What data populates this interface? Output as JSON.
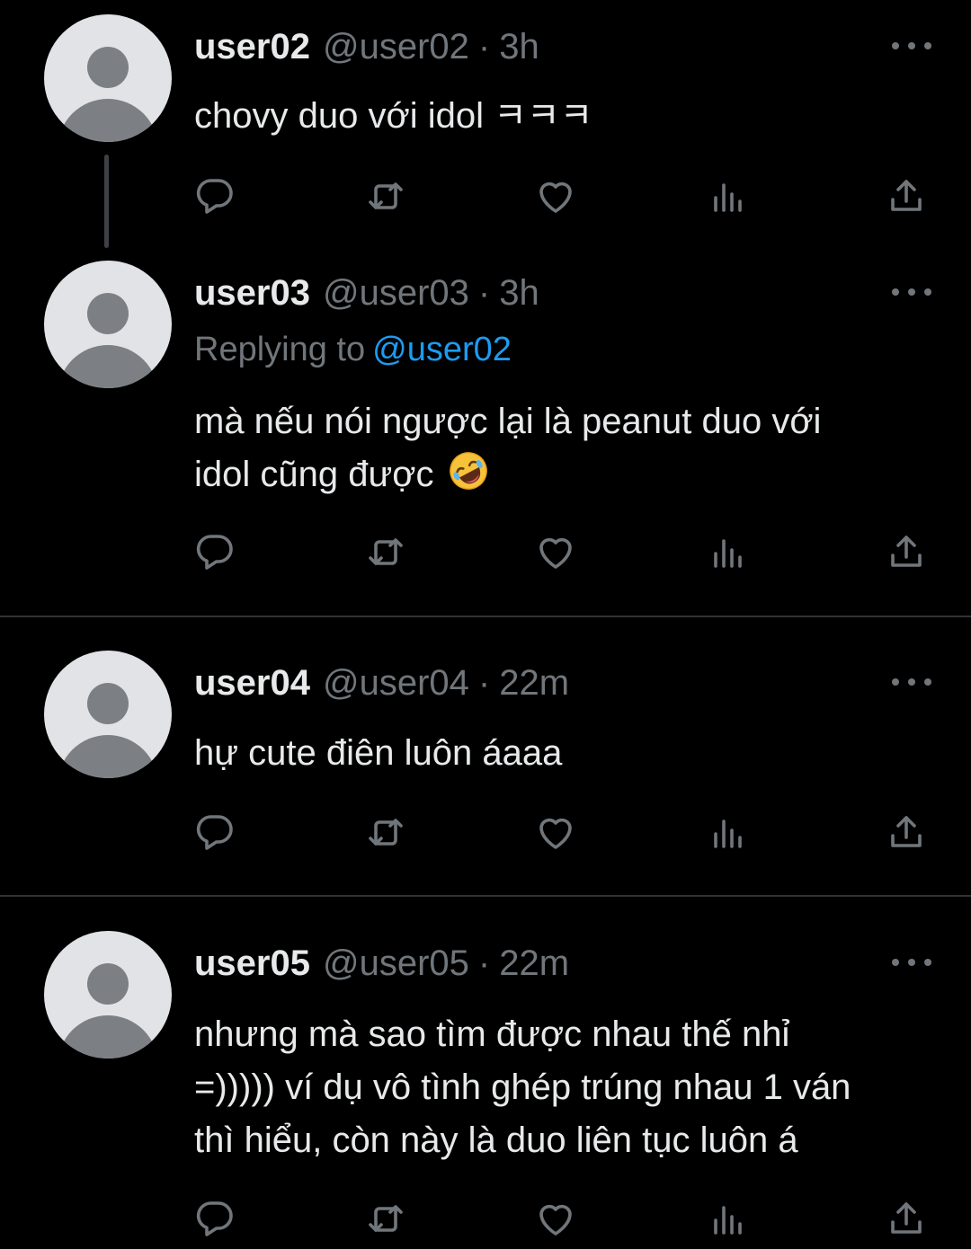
{
  "tweets": [
    {
      "name": "user02",
      "handle": "@user02",
      "sep": "·",
      "time": "3h",
      "text": "chovy duo với idol ㅋㅋㅋ"
    },
    {
      "name": "user03",
      "handle": "@user03",
      "sep": "·",
      "time": "3h",
      "replying_label": "Replying to",
      "replying_to": "@user02",
      "text_line1": "mà nếu nói ngược lại là peanut duo với",
      "text_line2": "idol cũng được",
      "emoji": "rolling-on-the-floor-laughing-emoji"
    },
    {
      "name": "user04",
      "handle": "@user04",
      "sep": "·",
      "time": "22m",
      "text": "hự cute điên luôn áaaa"
    },
    {
      "name": "user05",
      "handle": "@user05",
      "sep": "·",
      "time": "22m",
      "text_line1": "nhưng mà sao tìm được nhau thế nhỉ",
      "text_line2": "=))))) ví dụ vô tình ghép trúng nhau 1 ván",
      "text_line3": "thì hiểu, còn này là duo liên tục luôn á"
    }
  ],
  "action_icons": [
    "reply-icon",
    "retweet-icon",
    "like-icon",
    "views-icon",
    "share-icon"
  ],
  "colors": {
    "background": "#000000",
    "primary_text": "#e7e9ea",
    "secondary_text": "#71767b",
    "link": "#1d9bf0",
    "divider": "#2f3336",
    "avatar_bg": "#e1e3e6",
    "avatar_fg": "#7c7f84"
  }
}
